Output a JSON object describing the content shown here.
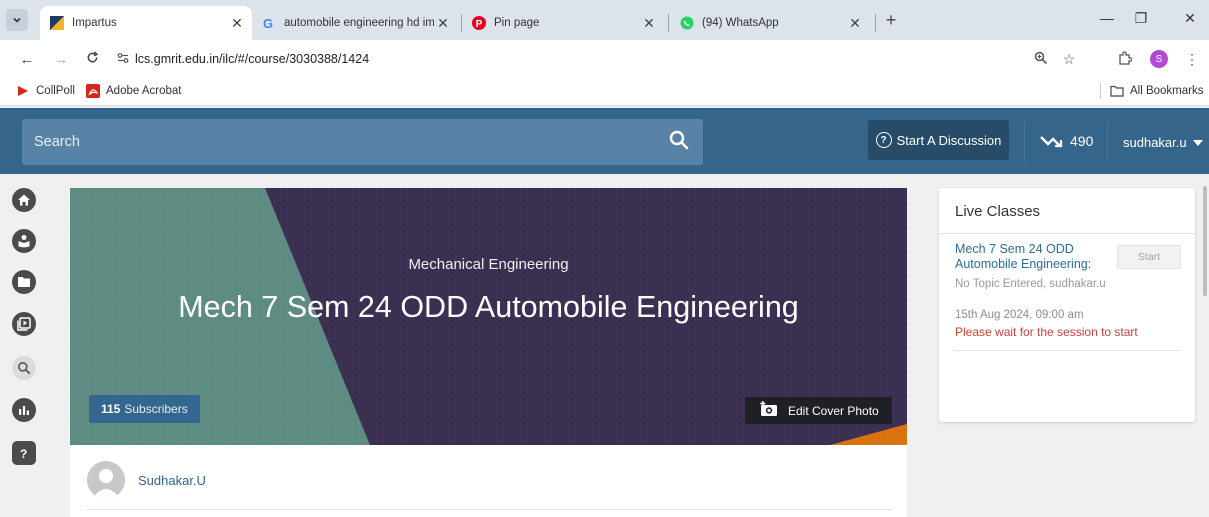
{
  "browser": {
    "tabs": [
      {
        "title": "Impartus",
        "icon": "impartus-icon",
        "active": true
      },
      {
        "title": "automobile engineering hd ima",
        "icon": "google-icon",
        "active": false
      },
      {
        "title": "Pin page",
        "icon": "pinterest-icon",
        "active": false
      },
      {
        "title": "(94) WhatsApp",
        "icon": "whatsapp-icon",
        "active": false
      }
    ],
    "new_tab": "+",
    "url": "lcs.gmrit.edu.in/ilc/#/course/3030388/1424",
    "bookmarks": [
      {
        "label": "CollPoll",
        "icon": "collpoll-icon"
      },
      {
        "label": "Adobe Acrobat",
        "icon": "acrobat-icon"
      }
    ],
    "all_bookmarks": "All Bookmarks",
    "profile_initial": "S"
  },
  "header": {
    "search_placeholder": "Search",
    "discussion_button": "Start A Discussion",
    "trend_count": "490",
    "username": "sudhakar.u"
  },
  "sidebar": {
    "items": [
      {
        "name": "home",
        "icon": "home-icon"
      },
      {
        "name": "teacher",
        "icon": "teacher-icon"
      },
      {
        "name": "folder",
        "icon": "folder-icon"
      },
      {
        "name": "video-library",
        "icon": "video-library-icon"
      },
      {
        "name": "search",
        "icon": "search-icon"
      },
      {
        "name": "analytics",
        "icon": "bar-chart-icon"
      },
      {
        "name": "help",
        "icon": "help-icon"
      }
    ]
  },
  "course": {
    "department": "Mechanical Engineering",
    "title": "Mech 7 Sem 24 ODD Automobile Engineering",
    "subscribers_count": "115",
    "subscribers_label": "Subscribers",
    "edit_cover_label": "Edit Cover Photo",
    "author": "Sudhakar.U"
  },
  "live_classes": {
    "title": "Live Classes",
    "items": [
      {
        "name": "Mech 7 Sem 24 ODD Automobile Engineering:",
        "topic": "No Topic Entered, sudhakar.u",
        "time": "15th Aug 2024, 09:00 am",
        "status": "Please wait for the session to start",
        "button": "Start"
      }
    ]
  },
  "colors": {
    "header_bg": "#35658a",
    "search_bg": "#5883a6",
    "link": "#2e6b9c",
    "warning": "#c9423a",
    "cover_teal": "#5e8b82",
    "cover_purple": "#3b2f52",
    "cover_orange": "#d9730f"
  }
}
